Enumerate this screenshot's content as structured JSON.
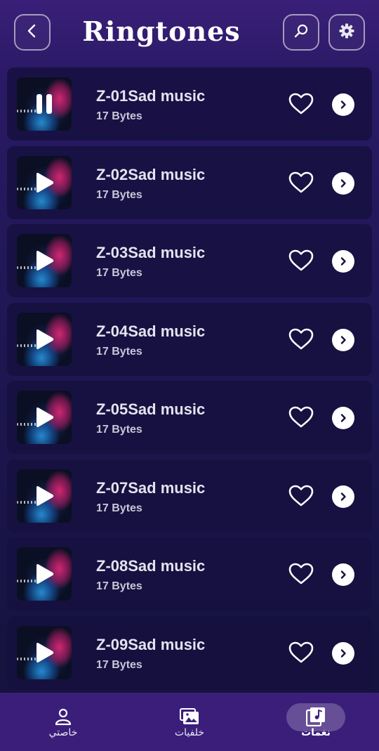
{
  "header": {
    "title": "Ringtones",
    "back_icon": "chevron-left-icon",
    "search_icon": "search-icon",
    "settings_icon": "gear-icon"
  },
  "ringtones": [
    {
      "name": "Z-01Sad music",
      "size": "17 Bytes",
      "state": "playing"
    },
    {
      "name": "Z-02Sad music",
      "size": "17 Bytes",
      "state": "paused"
    },
    {
      "name": "Z-03Sad music",
      "size": "17 Bytes",
      "state": "paused"
    },
    {
      "name": "Z-04Sad music",
      "size": "17 Bytes",
      "state": "paused"
    },
    {
      "name": "Z-05Sad music",
      "size": "17 Bytes",
      "state": "paused"
    },
    {
      "name": "Z-07Sad music",
      "size": "17 Bytes",
      "state": "paused"
    },
    {
      "name": "Z-08Sad music",
      "size": "17 Bytes",
      "state": "paused"
    },
    {
      "name": "Z-09Sad music",
      "size": "17 Bytes",
      "state": "paused"
    }
  ],
  "bottom_nav": {
    "items": [
      {
        "label": "خاصتي",
        "icon": "user-icon",
        "active": false
      },
      {
        "label": "خلفيات",
        "icon": "images-icon",
        "active": false
      },
      {
        "label": "نغمات",
        "icon": "music-library-icon",
        "active": true
      }
    ]
  },
  "colors": {
    "background_top": "#3a1f78",
    "background_bottom": "#14123a",
    "row_background": "#161040",
    "nav_background": "#3b1e7a"
  }
}
